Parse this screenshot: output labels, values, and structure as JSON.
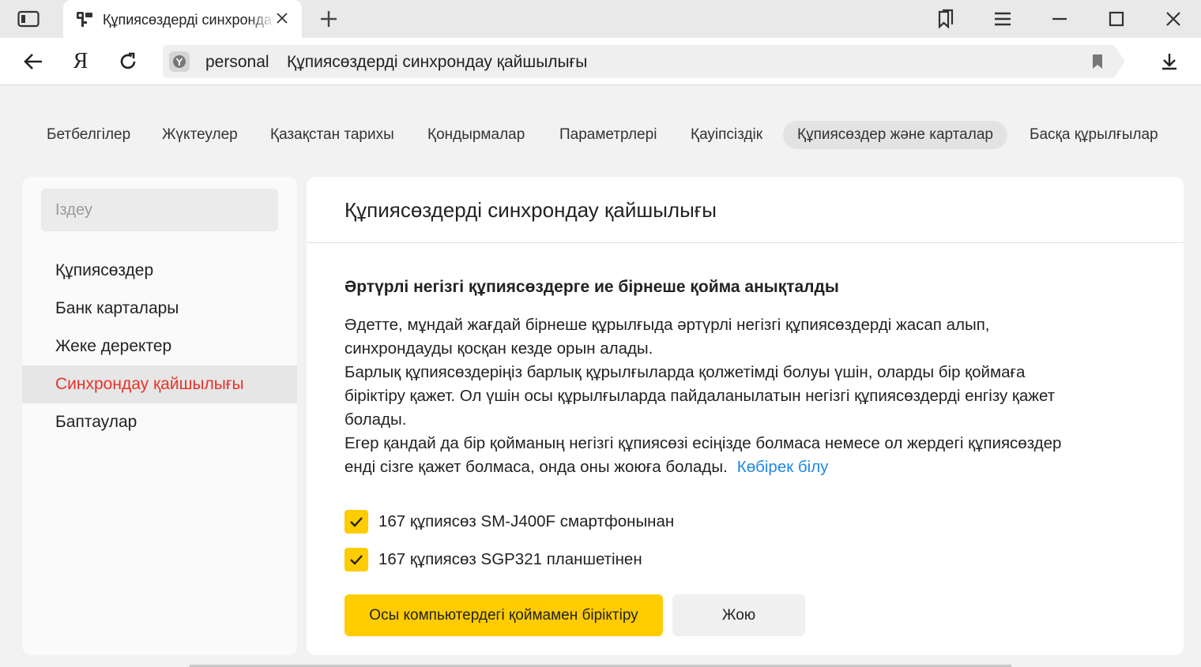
{
  "tab": {
    "title": "Құпиясөздерді синхрондау қайшылығы",
    "close_icon": "close-icon"
  },
  "address_bar": {
    "host": "personal",
    "page_title": "Құпиясөздерді синхрондау қайшылығы",
    "ya_label": "Я"
  },
  "settings_nav": {
    "items": [
      {
        "label": "Бетбелгілер"
      },
      {
        "label": "Жүктеулер"
      },
      {
        "label": "Қазақстан тарихы"
      },
      {
        "label": "Қондырмалар"
      },
      {
        "label": "Параметрлері"
      },
      {
        "label": "Қауіпсіздік"
      },
      {
        "label": "Құпиясөздер және карталар",
        "active": true
      },
      {
        "label": "Басқа құрылғылар"
      }
    ]
  },
  "sidebar": {
    "search_placeholder": "Іздеу",
    "items": [
      {
        "label": "Құпиясөздер"
      },
      {
        "label": "Банк карталары"
      },
      {
        "label": "Жеке деректер"
      },
      {
        "label": "Синхрондау қайшылығы",
        "active": true
      },
      {
        "label": "Баптаулар"
      }
    ]
  },
  "main": {
    "title": "Құпиясөздерді синхрондау қайшылығы",
    "heading": "Әртүрлі негізгі құпиясөздерге ие бірнеше қойма анықталды",
    "paragraphs": [
      "Әдетте, мұндай жағдай бірнеше құрылғыда әртүрлі негізгі құпиясөздерді жасап алып,\nсинхрондауды қосқан кезде орын алады.",
      "Барлық құпиясөздеріңіз барлық құрылғыларда қолжетімді болуы үшін, оларды бір қоймаға\nбіріктіру қажет. Ол үшін осы құрылғыларда пайдаланылатын негізгі құпиясөздерді енгізу қажет\nболады.",
      "Егер қандай да бір қойманың негізгі құпиясөзі есіңізде болмаса немесе ол жердегі құпиясөздер\nенді сізге қажет болмаса, онда оны жоюға болады."
    ],
    "learn_more": "Көбірек білу",
    "vaults": [
      {
        "label": "167 құпиясөз SM-J400F смартфонынан",
        "checked": true
      },
      {
        "label": "167 құпиясөз SGP321 планшетінен",
        "checked": true
      }
    ],
    "merge_button": "Осы компьютердегі қоймамен біріктіру",
    "delete_button": "Жою"
  },
  "colors": {
    "accent": "#ffcc00",
    "active_sidebar_text": "#e6332a",
    "link": "#1e88e5"
  }
}
